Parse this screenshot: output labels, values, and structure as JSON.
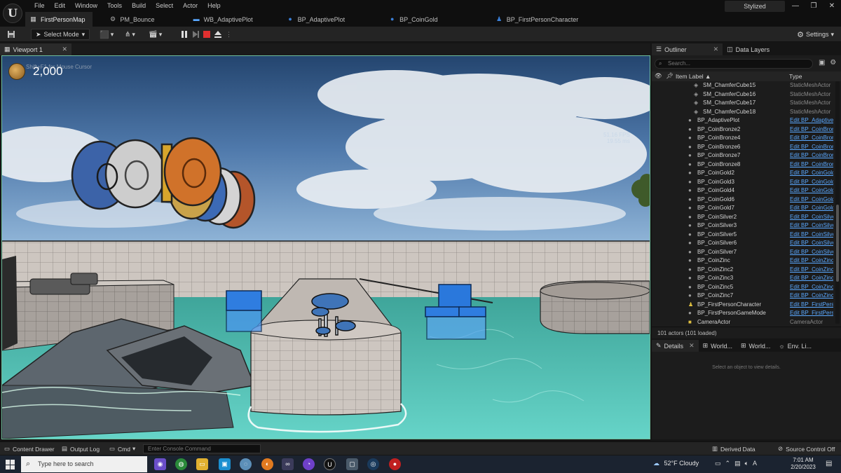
{
  "menu": [
    "File",
    "Edit",
    "Window",
    "Tools",
    "Build",
    "Select",
    "Actor",
    "Help"
  ],
  "doc_tabs": [
    {
      "label": "FirstPersonMap",
      "icon": "level-icon",
      "active": true
    },
    {
      "label": "PM_Bounce",
      "icon": "physical-material-icon",
      "active": false
    },
    {
      "label": "WB_AdaptivePlot",
      "icon": "widget-blueprint-icon",
      "active": false
    },
    {
      "label": "BP_AdaptivePlot",
      "icon": "blueprint-icon",
      "active": false
    },
    {
      "label": "BP_CoinGold",
      "icon": "blueprint-icon",
      "active": false
    },
    {
      "label": "BP_FirstPersonCharacter",
      "icon": "character-icon",
      "active": false
    }
  ],
  "layout_name": "Stylized",
  "window_controls": {
    "minimize": "—",
    "restore": "❐",
    "close": "✕"
  },
  "toolbar": {
    "select_mode": "Select Mode",
    "settings": "Settings"
  },
  "viewport": {
    "tab_label": "Viewport 1",
    "coin_count": "2,000",
    "cursor_hint": "Shift+F1 for Mouse Cursor",
    "fps": "51.16 FPS",
    "frame_ms": "19.55 ms"
  },
  "outliner": {
    "tabs": [
      {
        "label": "Outliner",
        "active": true
      },
      {
        "label": "Data Layers",
        "active": false
      }
    ],
    "search_placeholder": "Search...",
    "col_label": "Item Label ▲",
    "col_type": "Type",
    "rows": [
      {
        "name": "SM_ChamferCube15",
        "type": "StaticMeshActor",
        "indent": 2,
        "link": false,
        "icon": "mesh"
      },
      {
        "name": "SM_ChamferCube16",
        "type": "StaticMeshActor",
        "indent": 2,
        "link": false,
        "icon": "mesh"
      },
      {
        "name": "SM_ChamferCube17",
        "type": "StaticMeshActor",
        "indent": 2,
        "link": false,
        "icon": "mesh"
      },
      {
        "name": "SM_ChamferCube18",
        "type": "StaticMeshActor",
        "indent": 2,
        "link": false,
        "icon": "mesh"
      },
      {
        "name": "BP_AdaptivePlot",
        "type": "Edit BP_AdaptivePlot",
        "indent": 1,
        "link": true,
        "icon": "bp"
      },
      {
        "name": "BP_CoinBronze2",
        "type": "Edit BP_CoinBronze",
        "indent": 1,
        "link": true,
        "icon": "bp"
      },
      {
        "name": "BP_CoinBronze4",
        "type": "Edit BP_CoinBronze",
        "indent": 1,
        "link": true,
        "icon": "bp"
      },
      {
        "name": "BP_CoinBronze6",
        "type": "Edit BP_CoinBronze",
        "indent": 1,
        "link": true,
        "icon": "bp"
      },
      {
        "name": "BP_CoinBronze7",
        "type": "Edit BP_CoinBronze",
        "indent": 1,
        "link": true,
        "icon": "bp"
      },
      {
        "name": "BP_CoinBronze8",
        "type": "Edit BP_CoinBronze",
        "indent": 1,
        "link": true,
        "icon": "bp"
      },
      {
        "name": "BP_CoinGold2",
        "type": "Edit BP_CoinGold",
        "indent": 1,
        "link": true,
        "icon": "bp"
      },
      {
        "name": "BP_CoinGold3",
        "type": "Edit BP_CoinGold",
        "indent": 1,
        "link": true,
        "icon": "bp"
      },
      {
        "name": "BP_CoinGold4",
        "type": "Edit BP_CoinGold",
        "indent": 1,
        "link": true,
        "icon": "bp"
      },
      {
        "name": "BP_CoinGold6",
        "type": "Edit BP_CoinGold",
        "indent": 1,
        "link": true,
        "icon": "bp"
      },
      {
        "name": "BP_CoinGold7",
        "type": "Edit BP_CoinGold",
        "indent": 1,
        "link": true,
        "icon": "bp"
      },
      {
        "name": "BP_CoinSilver2",
        "type": "Edit BP_CoinSilver",
        "indent": 1,
        "link": true,
        "icon": "bp"
      },
      {
        "name": "BP_CoinSilver3",
        "type": "Edit BP_CoinSilver",
        "indent": 1,
        "link": true,
        "icon": "bp"
      },
      {
        "name": "BP_CoinSilver5",
        "type": "Edit BP_CoinSilver",
        "indent": 1,
        "link": true,
        "icon": "bp"
      },
      {
        "name": "BP_CoinSilver6",
        "type": "Edit BP_CoinSilver",
        "indent": 1,
        "link": true,
        "icon": "bp"
      },
      {
        "name": "BP_CoinSilver7",
        "type": "Edit BP_CoinSilver",
        "indent": 1,
        "link": true,
        "icon": "bp"
      },
      {
        "name": "BP_CoinZinc",
        "type": "Edit BP_CoinZinc",
        "indent": 1,
        "link": true,
        "icon": "bp"
      },
      {
        "name": "BP_CoinZinc2",
        "type": "Edit BP_CoinZinc",
        "indent": 1,
        "link": true,
        "icon": "bp"
      },
      {
        "name": "BP_CoinZinc3",
        "type": "Edit BP_CoinZinc",
        "indent": 1,
        "link": true,
        "icon": "bp"
      },
      {
        "name": "BP_CoinZinc5",
        "type": "Edit BP_CoinZinc",
        "indent": 1,
        "link": true,
        "icon": "bp"
      },
      {
        "name": "BP_CoinZinc7",
        "type": "Edit BP_CoinZinc",
        "indent": 1,
        "link": true,
        "icon": "bp"
      },
      {
        "name": "BP_FirstPersonCharacter",
        "type": "Edit BP_FirstPersonCharacter",
        "indent": 1,
        "link": true,
        "icon": "char"
      },
      {
        "name": "BP_FirstPersonGameMode",
        "type": "Edit BP_FirstPersonGameMode",
        "indent": 1,
        "link": true,
        "icon": "bp"
      },
      {
        "name": "CameraActor",
        "type": "CameraActor",
        "indent": 1,
        "link": false,
        "icon": "cam"
      }
    ],
    "footer": "101 actors (101 loaded)"
  },
  "details": {
    "tabs": [
      {
        "label": "Details",
        "active": true
      },
      {
        "label": "World...",
        "active": false
      },
      {
        "label": "World...",
        "active": false
      },
      {
        "label": "Env. Li...",
        "active": false
      }
    ],
    "empty_text": "Select an object to view details."
  },
  "bottombar": {
    "content_drawer": "Content Drawer",
    "output_log": "Output Log",
    "cmd": "Cmd",
    "console_placeholder": "Enter Console Command",
    "derived_data": "Derived Data",
    "source_control": "Source Control Off"
  },
  "taskbar": {
    "search_placeholder": "Type here to search",
    "weather": "52°F  Cloudy",
    "time": "7:01 AM",
    "date": "2/20/2023"
  },
  "colors": {
    "accent": "#5aa8ff",
    "viewport_border": "#6fbd9c",
    "taskbar": "#1b2330"
  }
}
